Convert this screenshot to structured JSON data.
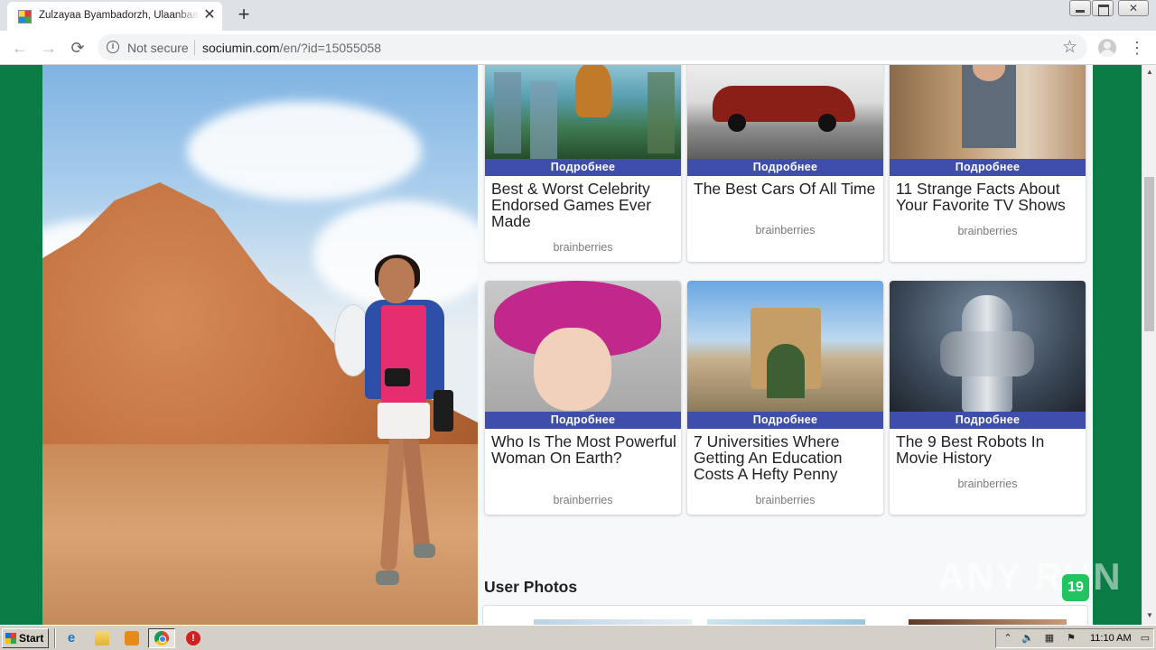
{
  "browser": {
    "tab_title": "Zulzayaa Byambadorzh, Ulaanbaatar",
    "tab_close": "✕",
    "new_tab": "+",
    "security_label": "Not secure",
    "url_host": "sociumin.com",
    "url_path": "/en/?id=15055058",
    "nav": {
      "back": "←",
      "forward": "→",
      "reload": "⟳"
    },
    "star": "☆",
    "menu": "⋮"
  },
  "cards": [
    {
      "label": "Подробнее",
      "title": "Best & Worst Celebrity Endorsed Games Ever Made",
      "source": "brainberries",
      "image": "video-game-character-jungle"
    },
    {
      "label": "Подробнее",
      "title": "The Best Cars Of All Time",
      "source": "brainberries",
      "image": "red-sedan-car"
    },
    {
      "label": "Подробнее",
      "title": "11 Strange Facts About Your Favorite TV Shows",
      "source": "brainberries",
      "image": "young-man-kitchen"
    },
    {
      "label": "Подробнее",
      "title": "Who Is The Most Powerful Woman On Earth?",
      "source": "brainberries",
      "image": "queen-pink-hat"
    },
    {
      "label": "Подробнее",
      "title": "7 Universities Where Getting An Education Costs A Hefty Penny",
      "source": "brainberries",
      "image": "university-campus-arch"
    },
    {
      "label": "Подробнее",
      "title": "The 9 Best Robots In Movie History",
      "source": "brainberries",
      "image": "robocop-robot"
    }
  ],
  "section": {
    "user_photos": "User Photos"
  },
  "badge": {
    "count": "19"
  },
  "watermark": "ANY RUN",
  "taskbar": {
    "start_label": "Start",
    "clock": "11:10 AM",
    "stop_glyph": "!",
    "ie_glyph": "e"
  }
}
